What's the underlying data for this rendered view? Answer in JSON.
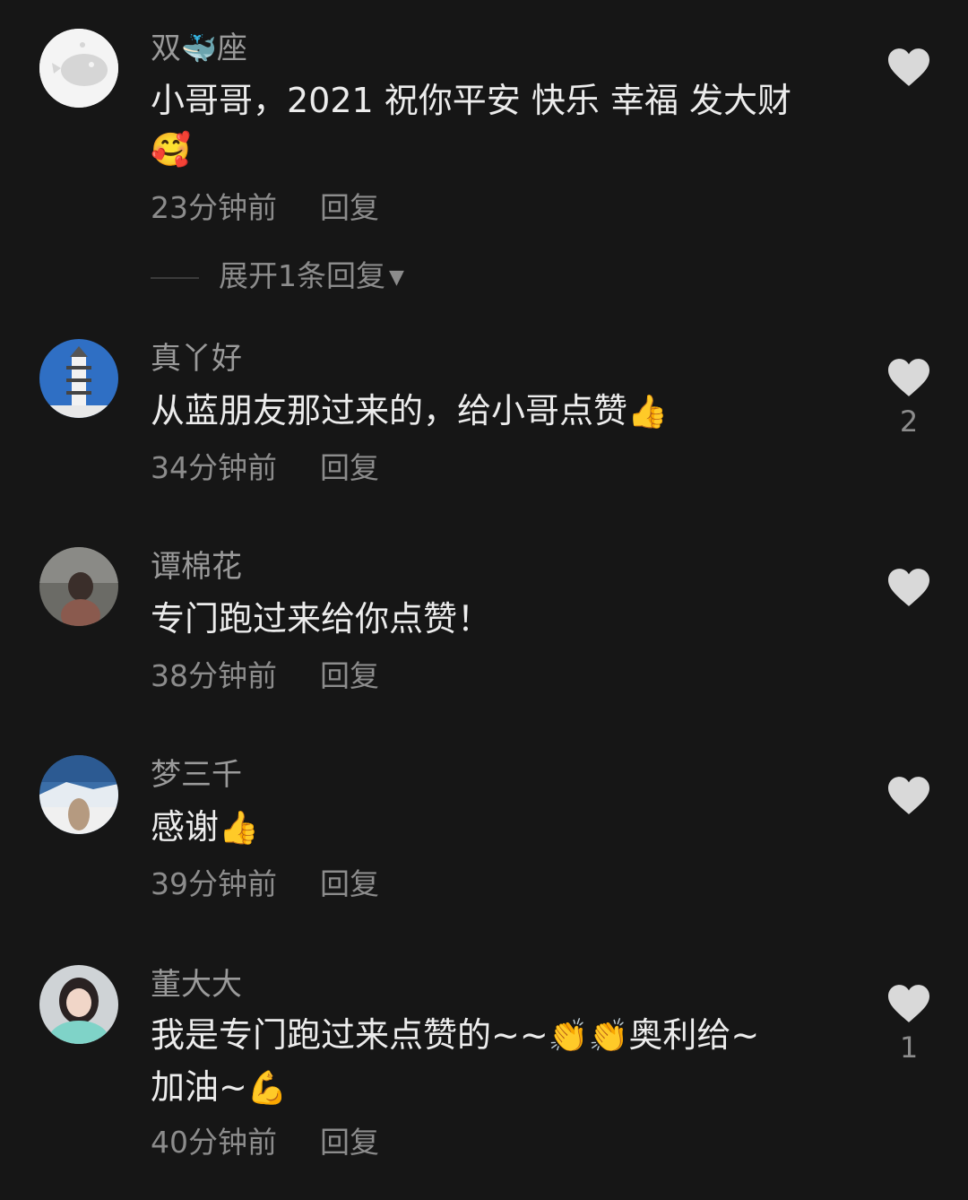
{
  "comments": [
    {
      "author_prefix": "双",
      "author_emoji": "🐳",
      "author_suffix": "座",
      "text_line1": "小哥哥，2021 祝你平安 快乐 幸福 发大财",
      "text_line2_emoji": "🥰",
      "time": "23分钟前",
      "reply": "回复",
      "avatar_icon": "ghost-whale-avatar",
      "expand_replies": "展开1条回复",
      "likes": ""
    },
    {
      "author": "真丫好",
      "text": "从蓝朋友那过来的，给小哥点赞",
      "text_emoji": "👍",
      "time": "34分钟前",
      "reply": "回复",
      "avatar_icon": "pagoda-avatar",
      "likes": "2"
    },
    {
      "author": "谭棉花",
      "text": "专门跑过来给你点赞！",
      "time": "38分钟前",
      "reply": "回复",
      "avatar_icon": "girl-photo-avatar",
      "likes": ""
    },
    {
      "author": "梦三千",
      "text": "感谢",
      "text_emoji": "👍",
      "time": "39分钟前",
      "reply": "回复",
      "avatar_icon": "snow-landscape-avatar",
      "likes": ""
    },
    {
      "author": "董大大",
      "text_line1": "我是专门跑过来点赞的~~",
      "text_line1_emoji": "👏👏",
      "text_line1_tail": "奥利给~",
      "text_line2": "加油~",
      "text_line2_emoji": "💪",
      "time": "40分钟前",
      "reply": "回复",
      "avatar_icon": "girl-portrait-avatar",
      "likes": "1"
    }
  ],
  "colors": {
    "background": "#161616",
    "author": "#9a9a9a",
    "text": "#ececec",
    "meta": "#8c8c8c",
    "heart": "#d9d9d9"
  }
}
